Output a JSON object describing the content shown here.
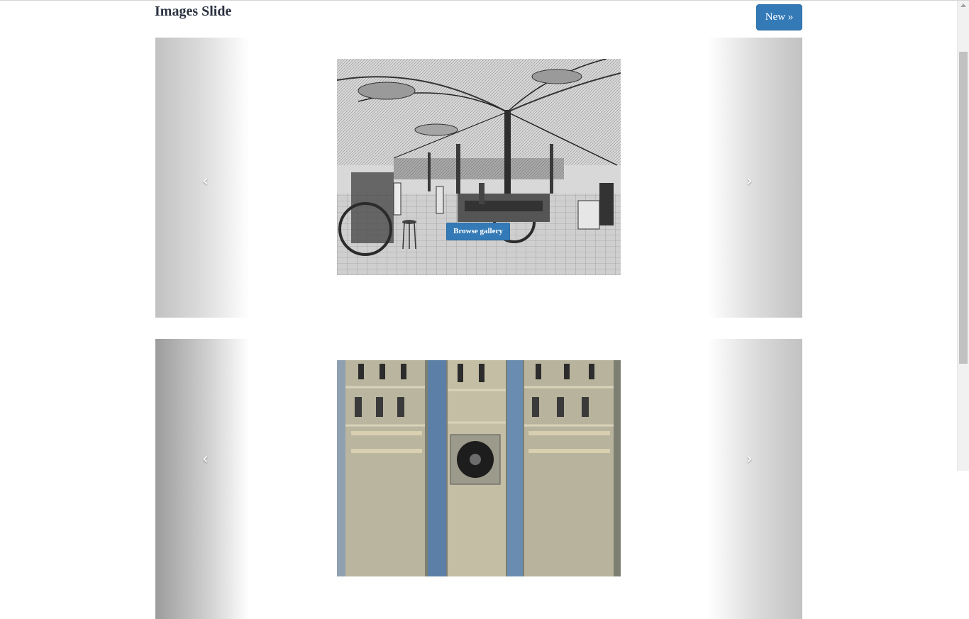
{
  "header": {
    "title": "Images Slide",
    "new_button_label": "New »"
  },
  "carousels": [
    {
      "prev_label": "‹",
      "next_label": "›",
      "image_subject": "engraving-factory-hall",
      "browse_label": "Browse gallery"
    },
    {
      "prev_label": "‹",
      "next_label": "›",
      "image_subject": "electronic-equipment-racks"
    }
  ],
  "colors": {
    "button_blue": "#337ab7",
    "title_text": "#2b3240"
  }
}
